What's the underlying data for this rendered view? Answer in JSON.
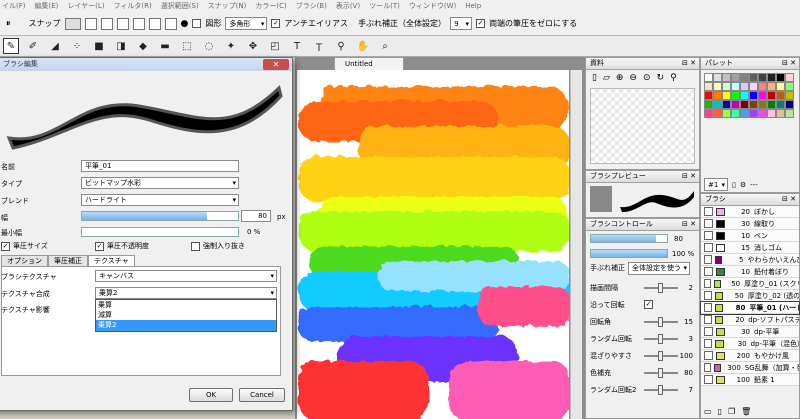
{
  "menubar": [
    "イル(F)",
    "編集(E)",
    "レイヤー(L)",
    "フィルタ(R)",
    "選択範囲(S)",
    "スナップ(N)",
    "カラー(C)",
    "ブラシ(B)",
    "表示(V)",
    "ツール(T)",
    "ウィンドウ(W)",
    "Help"
  ],
  "options": {
    "snap_label": "スナップ",
    "shape_label": "図形",
    "shape_value": "多角形",
    "antialias_label": "アンチエイリアス",
    "stabilizer_label": "手ぶれ補正（全体設定）",
    "stabilizer_value": "9",
    "pressure_zero_label": "両端の筆圧をゼロにする"
  },
  "canvas": {
    "tab_title": "Untitled"
  },
  "brush_dialog": {
    "title": "ブラシ編集",
    "name_label": "名前",
    "name_value": "平筆_01",
    "type_label": "タイプ",
    "type_value": "ビットマップ水彩",
    "blend_label": "ブレンド",
    "blend_value": "ハードライト",
    "width_label": "幅",
    "width_value": "80",
    "width_unit": "px",
    "width_level": 0.8,
    "minwidth_label": "最小幅",
    "minwidth_value": "0 %",
    "pressure_size_label": "筆圧サイズ",
    "pressure_opacity_label": "筆圧不透明度",
    "force_label": "強制入り抜き",
    "tabs": [
      "オプション",
      "筆圧補正",
      "テクスチャ"
    ],
    "texture_label": "ブラシテクスチャ",
    "texture_value": "キャンバス",
    "compose_label": "テクスチャ合成",
    "compose_value": "乗算2",
    "compose_options": [
      "乗算",
      "減算",
      "乗算2"
    ],
    "influence_label": "テクスチャ影響",
    "ok_label": "OK",
    "cancel_label": "Cancel"
  },
  "material_panel": {
    "title": "資料"
  },
  "palette_panel": {
    "title": "パレット",
    "number": "#1",
    "extra": "---",
    "colors": [
      "#ffffff",
      "#e0e0e0",
      "#c0c0c0",
      "#a0a0a0",
      "#808080",
      "#606060",
      "#404040",
      "#202020",
      "#000000",
      "#ffd0d0",
      "#ffe0c0",
      "#ffffc0",
      "#d0ffd0",
      "#c0ffff",
      "#d0d0ff",
      "#ffd0ff",
      "#ff8080",
      "#ffb080",
      "#ffff80",
      "#80ff80",
      "#ff0000",
      "#ff8000",
      "#ffff00",
      "#00ff00",
      "#00ffff",
      "#0000ff",
      "#ff00ff",
      "#c00000",
      "#c06000",
      "#c0c000",
      "#00c000",
      "#00c0c0",
      "#0000c0",
      "#c000c0",
      "#800000",
      "#804000",
      "#808000",
      "#008000",
      "#008080",
      "#000080",
      "#ff4080",
      "#ff6040",
      "#a0ff40",
      "#40ffa0",
      "#40a0ff",
      "#a040ff",
      "#ff40ff",
      "#ffc0e0",
      "#e0c0a0",
      "#c0e0a0"
    ]
  },
  "brush_preview": {
    "title": "ブラシプレビュー"
  },
  "brush_control": {
    "title": "ブラシコントロール",
    "size_value": "80",
    "opacity_value": "100 %",
    "size_level": 0.85,
    "opacity_level": 1.0,
    "stabilizer_label": "手ぶれ補正",
    "stabilizer_value": "全体設定を使う",
    "rows": [
      {
        "label": "描画間隔",
        "value": "2"
      },
      {
        "label": "沿って回転",
        "value": ""
      },
      {
        "label": "回転角",
        "value": "15"
      },
      {
        "label": "ランダム回転",
        "value": "3"
      },
      {
        "label": "混ざりやすさ",
        "value": "100"
      },
      {
        "label": "色補充",
        "value": "80"
      },
      {
        "label": "ランダム回転2",
        "value": "7"
      }
    ]
  },
  "brush_list": {
    "title": "ブラシ",
    "items": [
      {
        "size": "20",
        "name": "ぼかし",
        "color": "#f0b0f0"
      },
      {
        "size": "30",
        "name": "線取り",
        "color": "#000000"
      },
      {
        "size": "10",
        "name": "ペン",
        "color": "#000000"
      },
      {
        "size": "15",
        "name": "消しゴム",
        "color": "#ffffff"
      },
      {
        "size": "5",
        "name": "やわらかいえんぴつ",
        "color": "#800080"
      },
      {
        "size": "10",
        "name": "鉛付着ぼり",
        "color": "#408040"
      },
      {
        "size": "50",
        "name": "厚塗り_01 (スクリーン)",
        "color": "#c0e040"
      },
      {
        "size": "50",
        "name": "厚塗り_02 (透の絵)",
        "color": "#c0e040"
      },
      {
        "size": "80",
        "name": "平筆_01 (ハード)",
        "color": "#c0e040"
      },
      {
        "size": "20",
        "name": "dp-ソフトパステル",
        "color": "#c0e040"
      },
      {
        "size": "30",
        "name": "dp-平筆",
        "color": "#c0e040"
      },
      {
        "size": "30",
        "name": "dp-平筆（混色）",
        "color": "#c0e040"
      },
      {
        "size": "200",
        "name": "もやかけ風",
        "color": "#e0e060"
      },
      {
        "size": "300",
        "name": "SG乱舞（加算・発光）",
        "color": "#c060c0"
      },
      {
        "size": "100",
        "name": "鉛素 1",
        "color": "#e0e060"
      }
    ]
  },
  "colors": {
    "window_bg": "#f0f0f0",
    "selection": "#3399ff",
    "slider": "#8cc4f0"
  }
}
